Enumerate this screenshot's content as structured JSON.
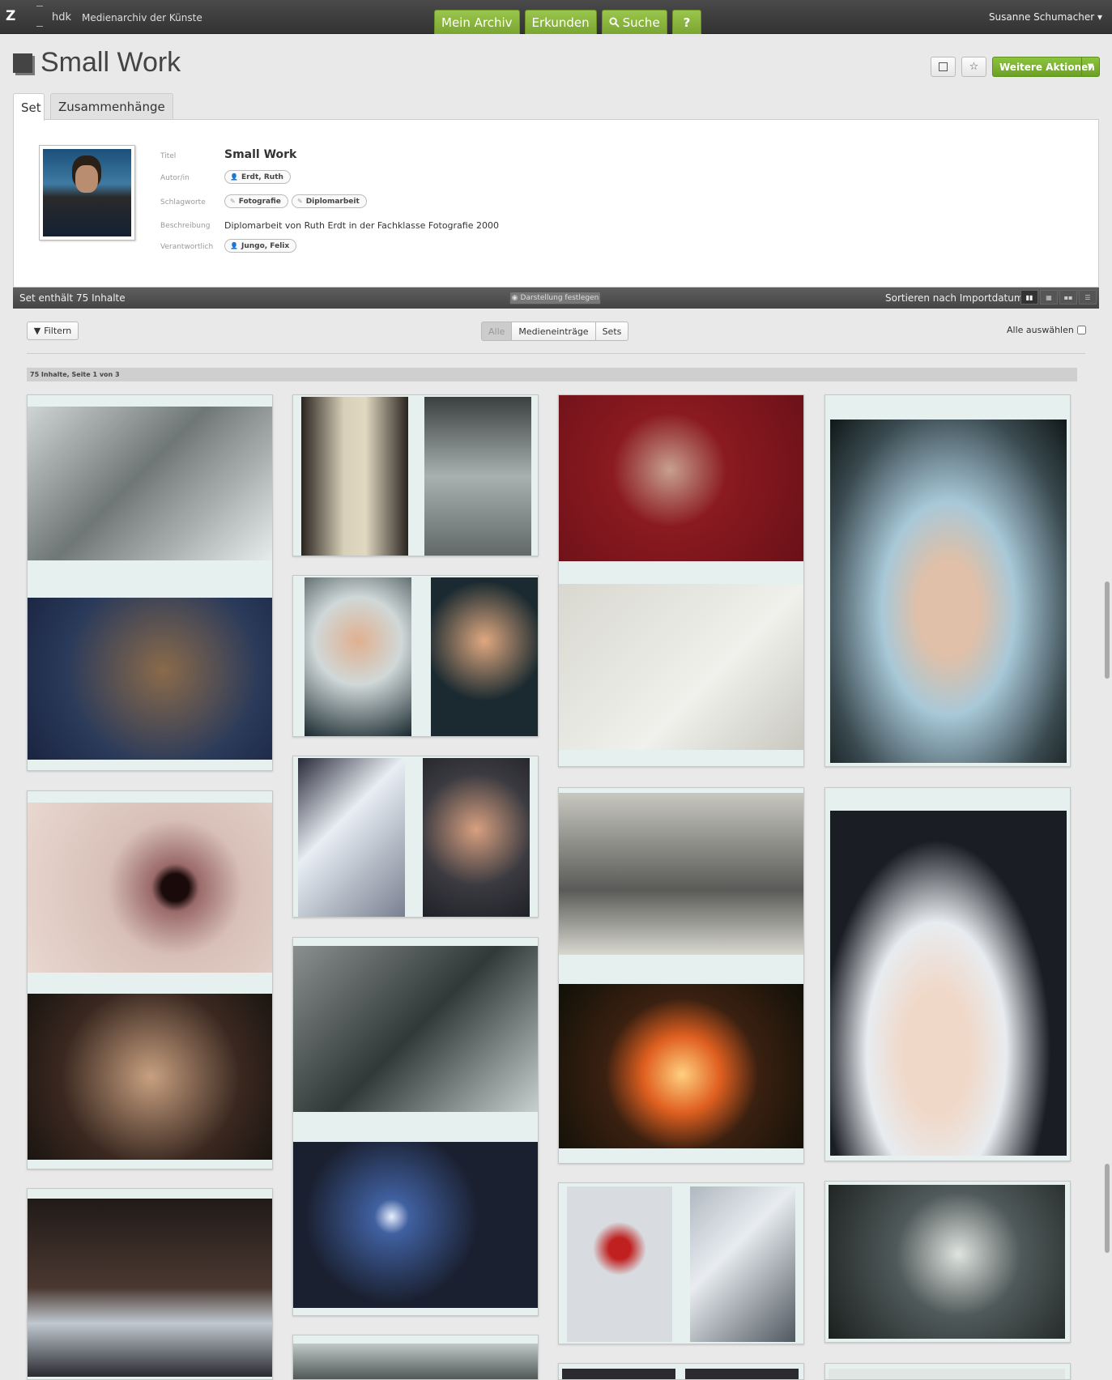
{
  "topbar": {
    "logo": "Z",
    "brand": "hdk",
    "subtitle": "Medienarchiv der Künste",
    "nav": [
      {
        "label": "Mein Archiv"
      },
      {
        "label": "Erkunden"
      },
      {
        "label": "Suche",
        "icon": "search-icon"
      },
      {
        "label": "?"
      }
    ],
    "user": "Susanne Schumacher ▾"
  },
  "page": {
    "title": "Small Work",
    "more_actions": "Weitere Aktionen"
  },
  "tabs": [
    {
      "label": "Set",
      "active": true
    },
    {
      "label": "Zusammenhänge",
      "active": false
    }
  ],
  "meta": {
    "labels": {
      "title": "Titel",
      "author": "Autor/in",
      "keywords": "Schlagworte",
      "description": "Beschreibung",
      "responsible": "Verantwortlich"
    },
    "title": "Small Work",
    "author": "Erdt, Ruth",
    "keywords": [
      "Fotografie",
      "Diplomarbeit"
    ],
    "description": "Diplomarbeit von Ruth Erdt in der Fachklasse Fotografie 2000",
    "responsible": "Jungo, Felix"
  },
  "setbar": {
    "count": "Set enthält 75 Inhalte",
    "fix_view": "Darstellung festlegen",
    "sort": "Sortieren nach Importdatum ▾"
  },
  "filter": {
    "button": "Filtern",
    "segments": [
      "Alle",
      "Medieneinträge",
      "Sets"
    ],
    "select_all": "Alle auswählen"
  },
  "pagination": "75 Inhalte, Seite 1 von 3",
  "colors": {
    "accent": "#8cc43d",
    "topbar": "#3c3c3c"
  }
}
